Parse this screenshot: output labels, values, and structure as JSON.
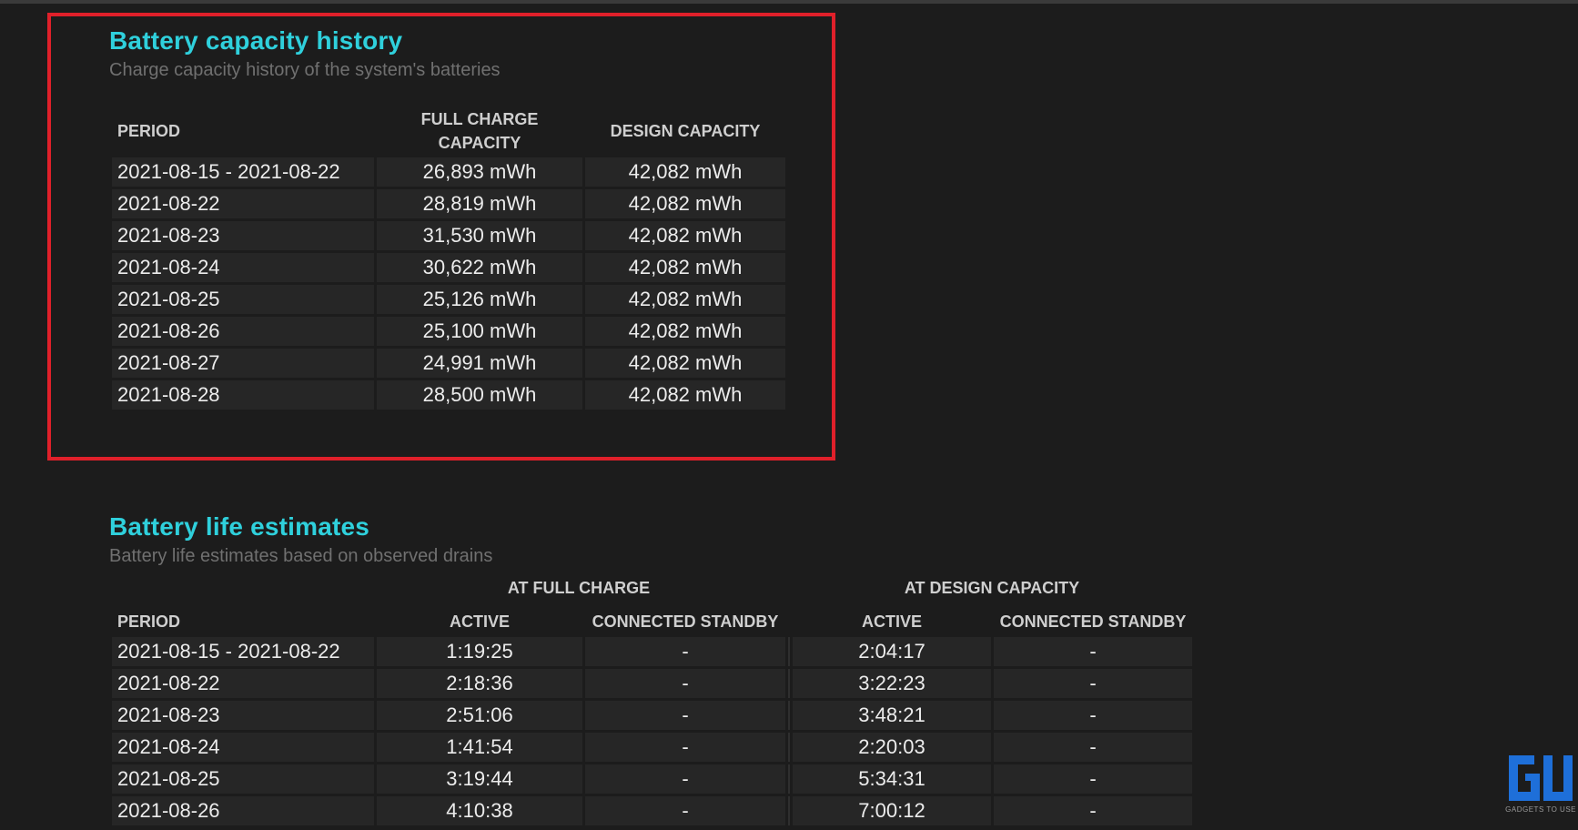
{
  "capacity_history": {
    "title": "Battery capacity history",
    "subtitle": "Charge capacity history of the system's batteries",
    "headers": {
      "period": "PERIOD",
      "full_charge_line1": "FULL CHARGE",
      "full_charge_line2": "CAPACITY",
      "design": "DESIGN CAPACITY"
    },
    "rows": [
      {
        "period": "2021-08-15 - 2021-08-22",
        "full": "26,893 mWh",
        "design": "42,082 mWh"
      },
      {
        "period": "2021-08-22",
        "full": "28,819 mWh",
        "design": "42,082 mWh"
      },
      {
        "period": "2021-08-23",
        "full": "31,530 mWh",
        "design": "42,082 mWh"
      },
      {
        "period": "2021-08-24",
        "full": "30,622 mWh",
        "design": "42,082 mWh"
      },
      {
        "period": "2021-08-25",
        "full": "25,126 mWh",
        "design": "42,082 mWh"
      },
      {
        "period": "2021-08-26",
        "full": "25,100 mWh",
        "design": "42,082 mWh"
      },
      {
        "period": "2021-08-27",
        "full": "24,991 mWh",
        "design": "42,082 mWh"
      },
      {
        "period": "2021-08-28",
        "full": "28,500 mWh",
        "design": "42,082 mWh"
      }
    ]
  },
  "life_estimates": {
    "title": "Battery life estimates",
    "subtitle": "Battery life estimates based on observed drains",
    "group_headers": {
      "full_charge": "AT FULL CHARGE",
      "design_capacity": "AT DESIGN CAPACITY"
    },
    "headers": {
      "period": "PERIOD",
      "active": "ACTIVE",
      "standby": "CONNECTED STANDBY",
      "design_active": "ACTIVE",
      "design_standby": "CONNECTED STANDBY"
    },
    "rows": [
      {
        "period": "2021-08-15 - 2021-08-22",
        "active": "1:19:25",
        "standby": "-",
        "design_active": "2:04:17",
        "design_standby": "-"
      },
      {
        "period": "2021-08-22",
        "active": "2:18:36",
        "standby": "-",
        "design_active": "3:22:23",
        "design_standby": "-"
      },
      {
        "period": "2021-08-23",
        "active": "2:51:06",
        "standby": "-",
        "design_active": "3:48:21",
        "design_standby": "-"
      },
      {
        "period": "2021-08-24",
        "active": "1:41:54",
        "standby": "-",
        "design_active": "2:20:03",
        "design_standby": "-"
      },
      {
        "period": "2021-08-25",
        "active": "3:19:44",
        "standby": "-",
        "design_active": "5:34:31",
        "design_standby": "-"
      },
      {
        "period": "2021-08-26",
        "active": "4:10:38",
        "standby": "-",
        "design_active": "7:00:12",
        "design_standby": "-"
      }
    ]
  },
  "watermark": {
    "text": "GADGETS TO USE",
    "icon": "gadgets-to-use-logo-icon",
    "color": "#1e6fd9"
  },
  "colors": {
    "title": "#2fd0dc",
    "highlight": "#e0202a",
    "background": "#1c1c1c",
    "row": "#262626"
  }
}
